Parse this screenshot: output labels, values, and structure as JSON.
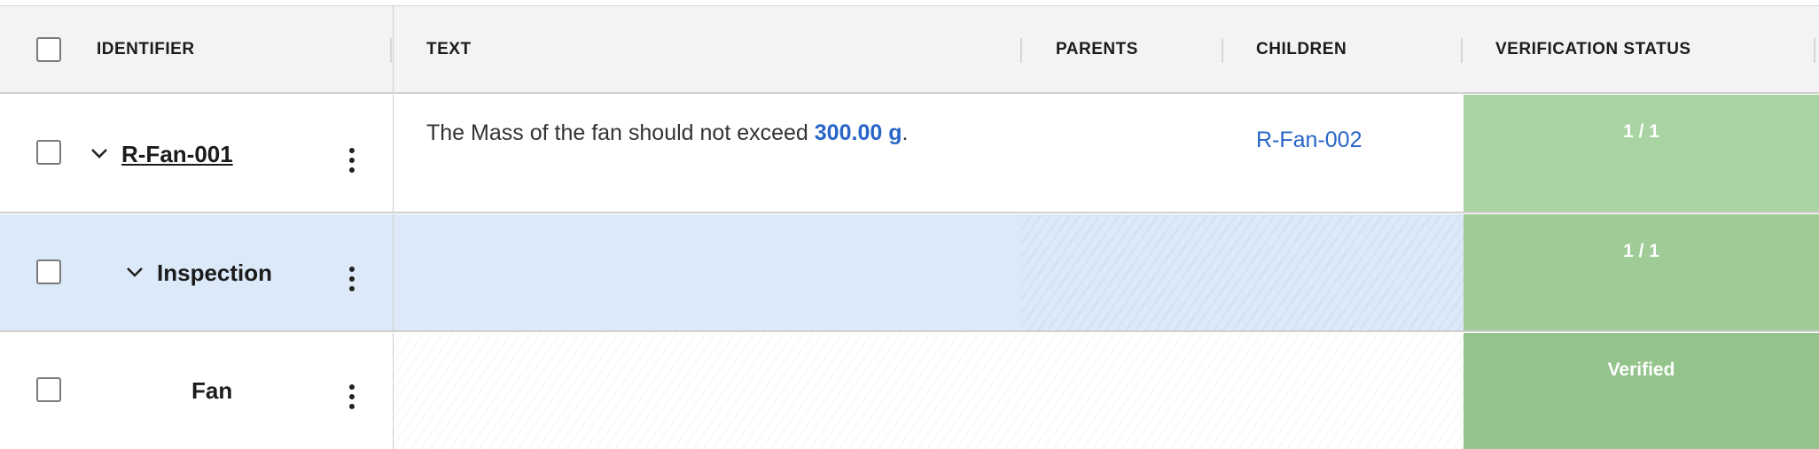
{
  "header": {
    "identifier": "IDENTIFIER",
    "text": "TEXT",
    "parents": "PARENTS",
    "children": "CHILDREN",
    "verification_status": "VERIFICATION STATUS"
  },
  "rows": [
    {
      "identifier": "R-Fan-001",
      "text_before": "The Mass of the fan should not exceed ",
      "value": "300.00",
      "unit": "g",
      "text_after": ".",
      "parents": "",
      "children": "R-Fan-002",
      "status": "1 / 1",
      "status_color": "#a9d3a3"
    },
    {
      "identifier": "Inspection",
      "status": "1 / 1",
      "status_color": "#9ecb96"
    },
    {
      "identifier": "Fan",
      "status": "Verified",
      "status_color": "#94c48c"
    }
  ],
  "colors": {
    "header_bg": "#f3f3f4",
    "selected_row_bg": "#dbe9f8",
    "link": "#2765c7"
  },
  "icons": [
    "checkbox-icon",
    "chevron-down-icon",
    "more-vertical-icon"
  ]
}
